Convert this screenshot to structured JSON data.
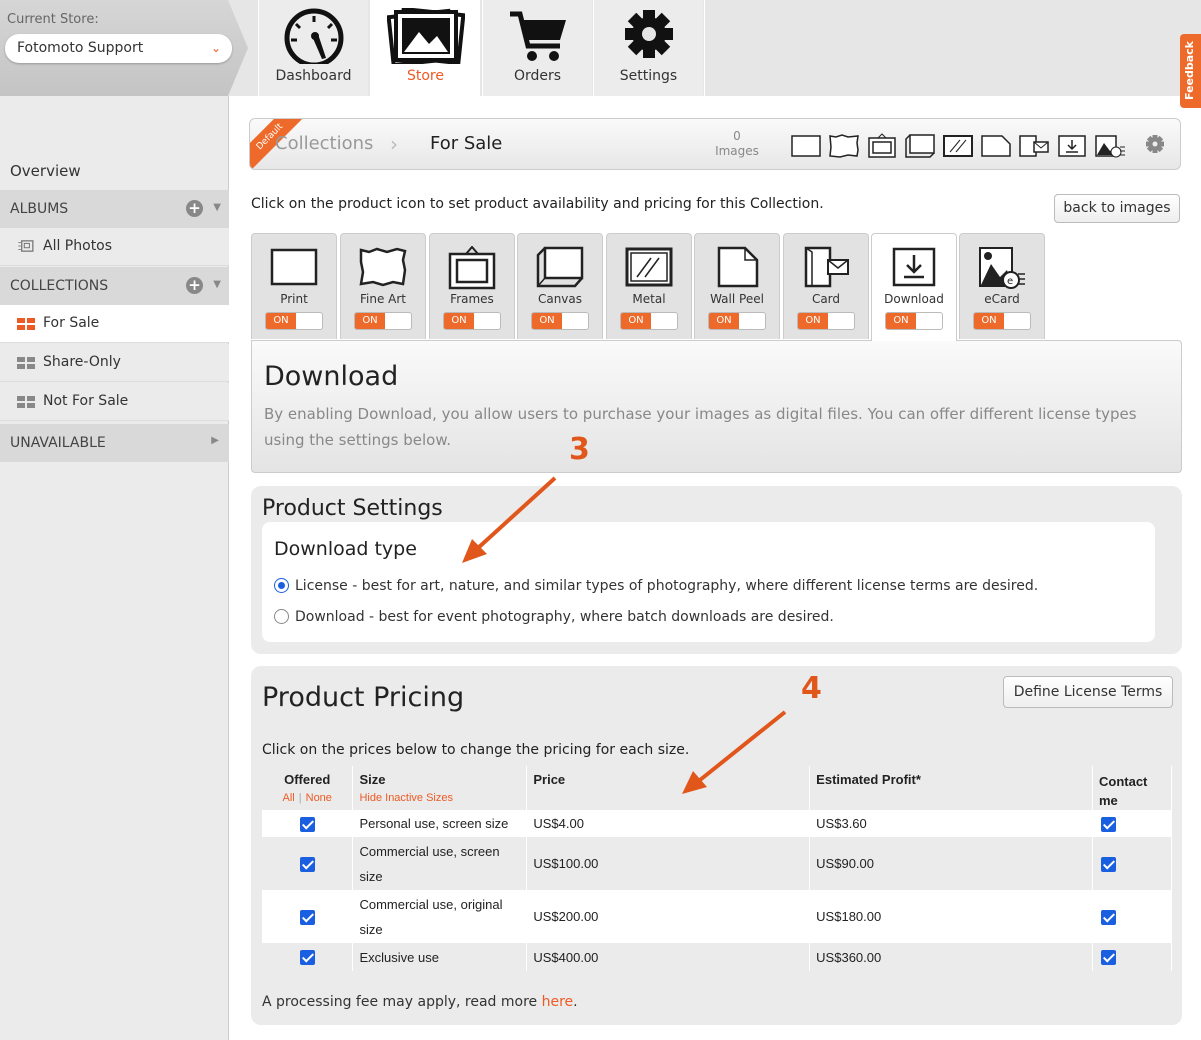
{
  "header": {
    "store_label": "Current Store:",
    "store_value": "Fotomoto Support",
    "store_chevron": "⌄",
    "nav": [
      {
        "label": "Dashboard",
        "icon": "gauge-icon"
      },
      {
        "label": "Store",
        "icon": "photos-icon"
      },
      {
        "label": "Orders",
        "icon": "cart-icon"
      },
      {
        "label": "Settings",
        "icon": "gear-icon"
      }
    ],
    "feedback": "Feedback"
  },
  "sidebar": {
    "overview": "Overview",
    "albums": "ALBUMS",
    "all_photos": "All Photos",
    "collections": "COLLECTIONS",
    "items": [
      "For Sale",
      "Share-Only",
      "Not For Sale"
    ],
    "unavailable": "UNAVAILABLE",
    "plus": "+"
  },
  "breadcrumb": {
    "tag": "Default",
    "collections": "Collections",
    "current": "For Sale",
    "images_count": "0",
    "images_label": "Images"
  },
  "intro": "Click on the product icon to set product availability and pricing for this Collection.",
  "back_button": "back to images",
  "product_tabs": [
    {
      "label": "Print",
      "toggle": "ON"
    },
    {
      "label": "Fine Art",
      "toggle": "ON"
    },
    {
      "label": "Frames",
      "toggle": "ON"
    },
    {
      "label": "Canvas",
      "toggle": "ON"
    },
    {
      "label": "Metal",
      "toggle": "ON"
    },
    {
      "label": "Wall Peel",
      "toggle": "ON"
    },
    {
      "label": "Card",
      "toggle": "ON"
    },
    {
      "label": "Download",
      "toggle": "ON"
    },
    {
      "label": "eCard",
      "toggle": "ON"
    }
  ],
  "download_panel": {
    "title": "Download",
    "description": "By enabling Download, you allow users to purchase your images as digital files. You can offer different license types using the settings below."
  },
  "settings": {
    "title": "Product Settings",
    "download_type_title": "Download type",
    "option_license": "License - best for art, nature, and similar types of photography, where different license terms are desired.",
    "option_download": "Download - best for event photography, where batch downloads are desired.",
    "selected": "license"
  },
  "pricing": {
    "title": "Product Pricing",
    "define_button": "Define License Terms",
    "intro": "Click on the prices below to change the pricing for each size.",
    "headers": {
      "offered": "Offered",
      "all": "All",
      "none": "None",
      "size": "Size",
      "hide_inactive": "Hide Inactive Sizes",
      "price": "Price",
      "profit": "Estimated Profit*",
      "contact": "Contact me"
    },
    "rows": [
      {
        "size": "Personal use, screen size",
        "price": "US$4.00",
        "profit": "US$3.60",
        "offered": true,
        "contact": true
      },
      {
        "size": "Commercial use, screen size",
        "price": "US$100.00",
        "profit": "US$90.00",
        "offered": true,
        "contact": true
      },
      {
        "size": "Commercial use, original size",
        "price": "US$200.00",
        "profit": "US$180.00",
        "offered": true,
        "contact": true
      },
      {
        "size": "Exclusive use",
        "price": "US$400.00",
        "profit": "US$360.00",
        "offered": true,
        "contact": true
      }
    ],
    "fee_text": "A processing fee may apply, read more ",
    "fee_link": "here",
    "fee_end": "."
  },
  "annotations": {
    "callout_3": "3",
    "callout_4": "4"
  },
  "colors": {
    "accent": "#ee5a24",
    "checkbox": "#1a5fe0",
    "annotation": "#e0561b"
  }
}
